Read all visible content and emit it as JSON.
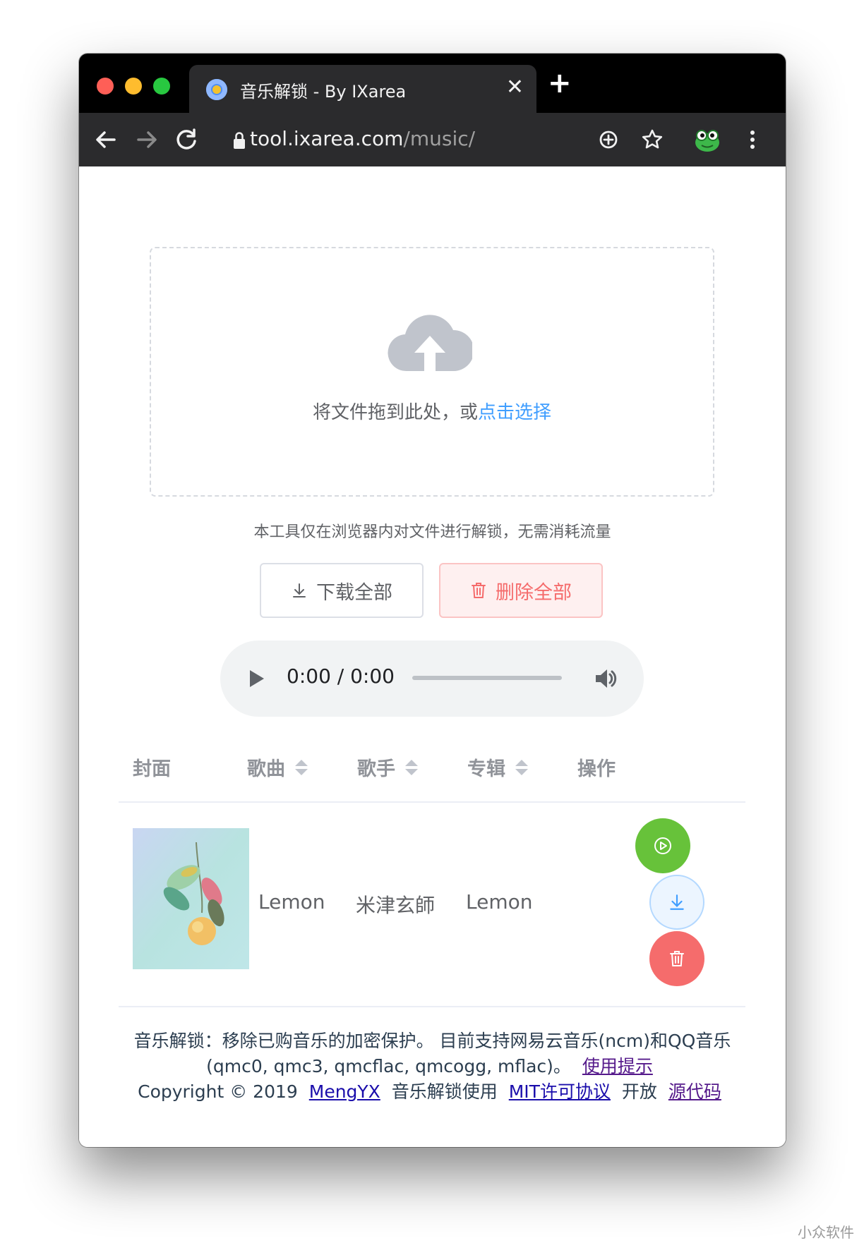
{
  "browser": {
    "tab_title": "音乐解锁 - By IXarea",
    "tab_close": "✕",
    "new_tab": "+",
    "url_host": "tool.ixarea.com",
    "url_path": "/music/"
  },
  "upload": {
    "drag_text": "将文件拖到此处，或",
    "click_text": "点击选择",
    "tip": "本工具仅在浏览器内对文件进行解锁，无需消耗流量"
  },
  "actions": {
    "download_all": "下载全部",
    "delete_all": "删除全部"
  },
  "player": {
    "time": "0:00 / 0:00"
  },
  "table": {
    "headers": [
      "封面",
      "歌曲",
      "歌手",
      "专辑",
      "操作"
    ],
    "rows": [
      {
        "title": "Lemon",
        "artist": "米津玄師",
        "album": "Lemon"
      }
    ]
  },
  "footer": {
    "line1": "音乐解锁：移除已购音乐的加密保护。 目前支持网易云音乐(ncm)和QQ音乐",
    "line2": "(qmc0, qmc3, qmcflac, qmcogg, mflac)。",
    "usage_link": "使用提示",
    "copyright": "Copyright © 2019",
    "author_link": "MengYX",
    "license_text": "音乐解锁使用",
    "license_link": "MIT许可协议",
    "open_text": "开放",
    "source_link": "源代码"
  },
  "watermark": "小众软件",
  "colors": {
    "accent": "#409eff",
    "success": "#67c23a",
    "danger": "#f56c6c"
  }
}
